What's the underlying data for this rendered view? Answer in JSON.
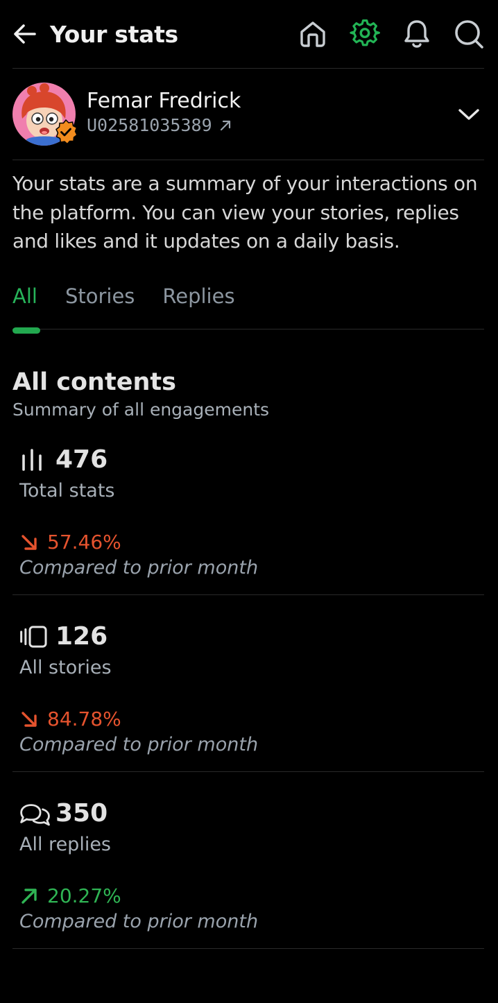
{
  "header": {
    "title": "Your stats",
    "icons": [
      "home-icon",
      "gear-icon",
      "bell-icon",
      "search-icon"
    ],
    "accent_color": "#22b455"
  },
  "profile": {
    "name": "Femar Fredrick",
    "user_id": "U02581035389",
    "badge_color": "#f28c1e"
  },
  "description": "Your stats are a summary of your interactions on the platform. You can view your stories, replies and likes and it updates on a daily basis.",
  "tabs": [
    {
      "label": "All",
      "active": true
    },
    {
      "label": "Stories",
      "active": false
    },
    {
      "label": "Replies",
      "active": false
    }
  ],
  "section": {
    "title": "All contents",
    "subtitle": "Summary of all engagements"
  },
  "stats": [
    {
      "icon": "bar-chart-icon",
      "value": "476",
      "label": "Total stats",
      "change": "57.46%",
      "direction": "down",
      "compare": "Compared to prior month"
    },
    {
      "icon": "stories-icon",
      "value": "126",
      "label": "All stories",
      "change": "84.78%",
      "direction": "down",
      "compare": "Compared to prior month"
    },
    {
      "icon": "replies-icon",
      "value": "350",
      "label": "All replies",
      "change": "20.27%",
      "direction": "up",
      "compare": "Compared to prior month"
    }
  ],
  "colors": {
    "down": "#e5532e",
    "up": "#2fb454",
    "background": "#000000"
  }
}
